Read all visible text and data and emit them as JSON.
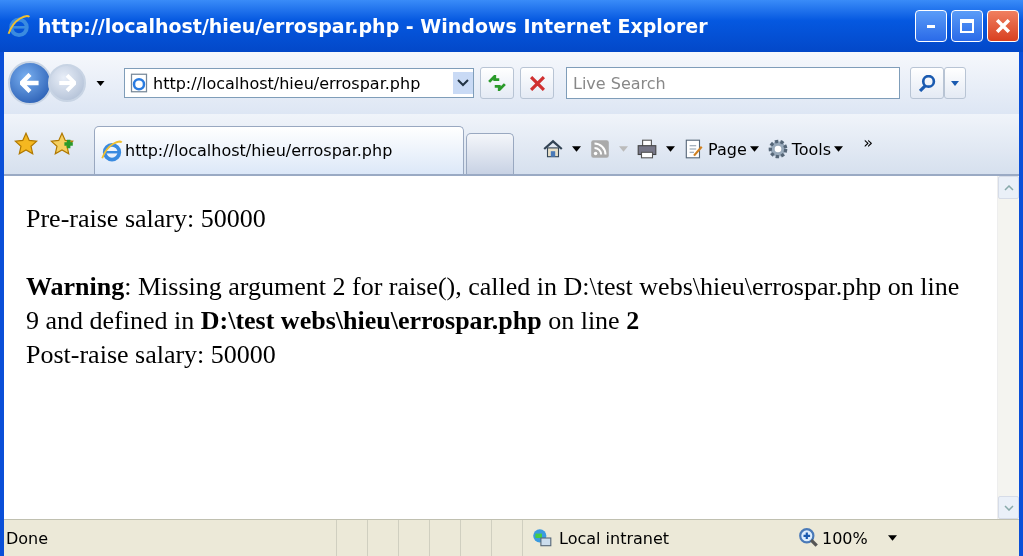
{
  "window": {
    "title": "http://localhost/hieu/errospar.php - Windows Internet Explorer"
  },
  "address_bar": {
    "value": "http://localhost/hieu/errospar.php"
  },
  "search": {
    "placeholder": "Live Search"
  },
  "tabs": [
    {
      "label": "http://localhost/hieu/errospar.php",
      "selected": true
    }
  ],
  "command_bar": {
    "page": "Page",
    "tools": "Tools",
    "more": "»"
  },
  "content": {
    "paragraphs": [
      {
        "text": "Pre-raise salary: 50000"
      },
      {
        "text": "**Warning**: Missing argument 2 for raise(), called in D:\\test webs\\hieu\\errospar.php on line 9 and defined in **D:\\test webs\\hieu\\errospar.php** on line **2**"
      },
      {
        "text": "Post-raise salary: 50000"
      }
    ]
  },
  "status_bar": {
    "status": "Done",
    "zone": "Local intranet",
    "zoom": "100%"
  }
}
